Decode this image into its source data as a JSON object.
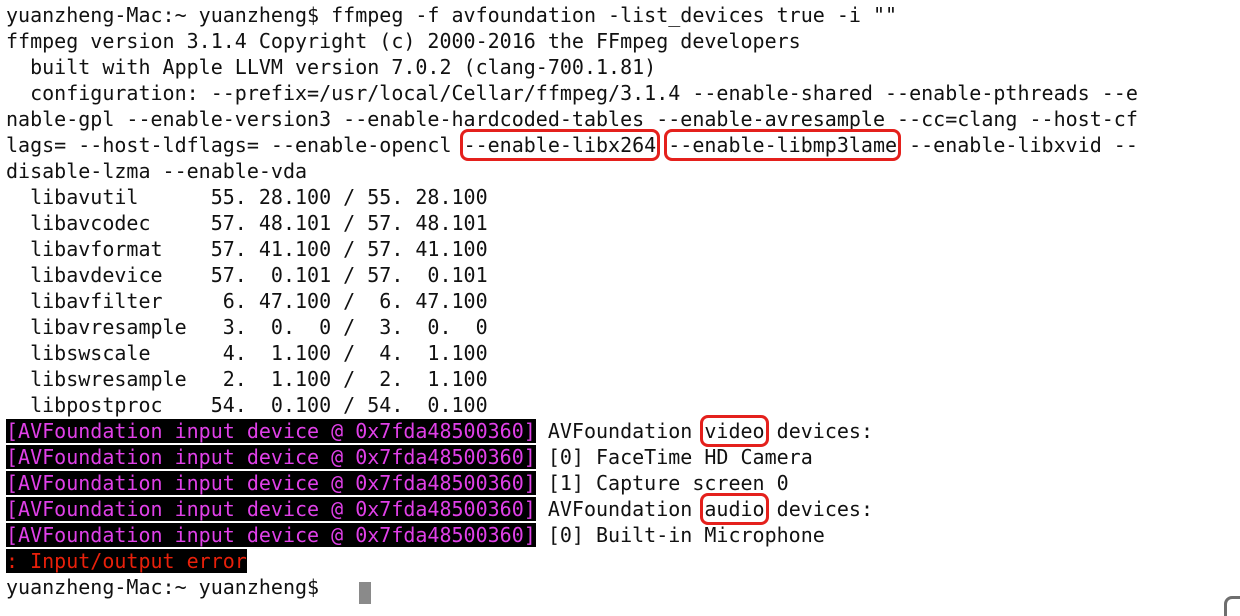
{
  "terminal": {
    "lines": [
      [
        {
          "text": "yuanzheng-Mac:~ yuanzheng$ ffmpeg -f avfoundation -list_devices true -i \"\""
        }
      ],
      [
        {
          "text": "ffmpeg version 3.1.4 Copyright (c) 2000-2016 the FFmpeg developers"
        }
      ],
      [
        {
          "text": "  built with Apple LLVM version 7.0.2 (clang-700.1.81)"
        }
      ],
      [
        {
          "text": "  configuration: --prefix=/usr/local/Cellar/ffmpeg/3.1.4 --enable-shared --enable-pthreads --e"
        }
      ],
      [
        {
          "text": "nable-gpl --enable-version3 --enable-hardcoded-tables --enable-avresample --cc=clang --host-cf"
        }
      ],
      [
        {
          "text": "lags= --host-ldflags= --enable-opencl "
        },
        {
          "text": "--enable-libx264",
          "style": "boxed"
        },
        {
          "text": " "
        },
        {
          "text": "--enable-libmp3lame",
          "style": "boxed"
        },
        {
          "text": " --enable-libxvid --"
        }
      ],
      [
        {
          "text": "disable-lzma --enable-vda"
        }
      ],
      [
        {
          "text": "  libavutil      55. 28.100 / 55. 28.100"
        }
      ],
      [
        {
          "text": "  libavcodec     57. 48.101 / 57. 48.101"
        }
      ],
      [
        {
          "text": "  libavformat    57. 41.100 / 57. 41.100"
        }
      ],
      [
        {
          "text": "  libavdevice    57.  0.101 / 57.  0.101"
        }
      ],
      [
        {
          "text": "  libavfilter     6. 47.100 /  6. 47.100"
        }
      ],
      [
        {
          "text": "  libavresample   3.  0.  0 /  3.  0.  0"
        }
      ],
      [
        {
          "text": "  libswscale      4.  1.100 /  4.  1.100"
        }
      ],
      [
        {
          "text": "  libswresample   2.  1.100 /  2.  1.100"
        }
      ],
      [
        {
          "text": "  libpostproc    54.  0.100 / 54.  0.100"
        }
      ],
      [
        {
          "text": "[AVFoundation input device @ 0x7fda48500360]",
          "style": "tag"
        },
        {
          "text": " AVFoundation "
        },
        {
          "text": "video",
          "style": "boxed"
        },
        {
          "text": " devices:"
        }
      ],
      [
        {
          "text": "[AVFoundation input device @ 0x7fda48500360]",
          "style": "tag"
        },
        {
          "text": " [0] FaceTime HD Camera"
        }
      ],
      [
        {
          "text": "[AVFoundation input device @ 0x7fda48500360]",
          "style": "tag"
        },
        {
          "text": " [1] Capture screen 0"
        }
      ],
      [
        {
          "text": "[AVFoundation input device @ 0x7fda48500360]",
          "style": "tag"
        },
        {
          "text": " AVFoundation "
        },
        {
          "text": "audio",
          "style": "boxed"
        },
        {
          "text": " devices:"
        }
      ],
      [
        {
          "text": "[AVFoundation input device @ 0x7fda48500360]",
          "style": "tag"
        },
        {
          "text": " [0] Built-in Microphone"
        }
      ],
      [
        {
          "text": ": Input/output error",
          "style": "err"
        }
      ],
      [
        {
          "text": "yuanzheng-Mac:~ yuanzheng$ "
        }
      ]
    ],
    "colors": {
      "background": "#ffffff",
      "text": "#111111",
      "log_tag_text": "#e040e8",
      "log_tag_background": "#000000",
      "error_text": "#e8200a",
      "highlight_box": "#e4201c",
      "cursor": "#8a8a8a"
    }
  }
}
